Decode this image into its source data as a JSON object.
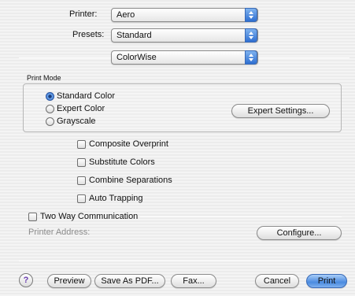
{
  "printer": {
    "label": "Printer:",
    "value": "Aero"
  },
  "presets": {
    "label": "Presets:",
    "value": "Standard"
  },
  "panel": {
    "value": "ColorWise"
  },
  "print_mode": {
    "title": "Print Mode",
    "options": [
      "Standard Color",
      "Expert Color",
      "Grayscale"
    ],
    "selected_index": 0,
    "expert_settings_label": "Expert Settings..."
  },
  "checkboxes": [
    "Composite Overprint",
    "Substitute Colors",
    "Combine Separations",
    "Auto Trapping"
  ],
  "two_way": {
    "label": "Two Way Communication",
    "address_label": "Printer Address:",
    "configure_label": "Configure..."
  },
  "footer": {
    "help_glyph": "?",
    "preview": "Preview",
    "save_pdf": "Save As PDF...",
    "fax": "Fax...",
    "cancel": "Cancel",
    "print": "Print"
  },
  "colors": {
    "accent": "#4b8be0",
    "help_icon": "#6a3db0"
  }
}
